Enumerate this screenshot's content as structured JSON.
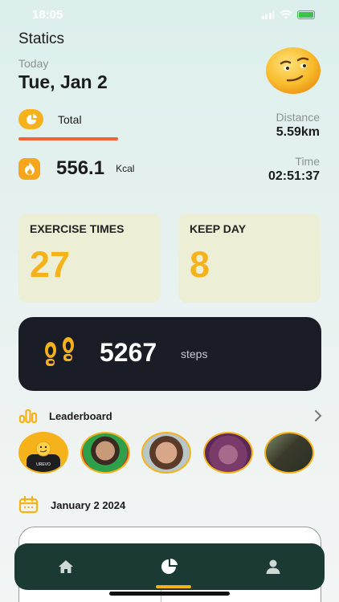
{
  "status_bar": {
    "time": "18:05"
  },
  "header": {
    "title": "Statics",
    "today_label": "Today",
    "date": "Tue, Jan 2"
  },
  "summary": {
    "total_label": "Total",
    "distance_label": "Distance",
    "distance_value": "5.59km",
    "time_label": "Time",
    "time_value": "02:51:37",
    "kcal_value": "556.1",
    "kcal_unit": "Kcal"
  },
  "cards": [
    {
      "label": "EXERCISE TIMES",
      "value": "27"
    },
    {
      "label": "KEEP DAY",
      "value": "8"
    }
  ],
  "steps": {
    "value": "5267",
    "unit": "steps"
  },
  "leaderboard": {
    "label": "Leaderboard"
  },
  "calendar": {
    "label": "January 2 2024"
  },
  "nav": {
    "items": [
      {
        "name": "home-icon",
        "active": false
      },
      {
        "name": "statistics-pie-icon",
        "active": true
      },
      {
        "name": "profile-icon",
        "active": false
      }
    ]
  },
  "colors": {
    "accent": "#f6b21b",
    "underline": "#f06534",
    "steps_card": "#1a1d26",
    "tabbar": "#1b3a34",
    "card_bg": "#ecefd6"
  }
}
